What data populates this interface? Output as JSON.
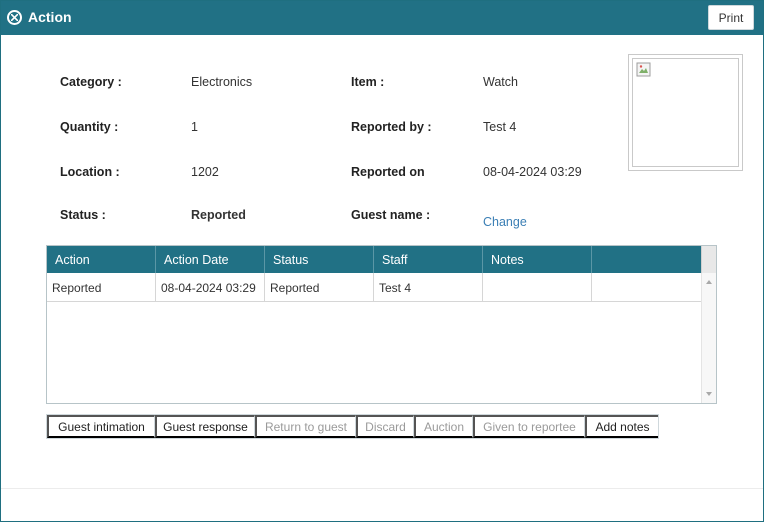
{
  "window": {
    "title": "Action",
    "print_label": "Print"
  },
  "details": {
    "category_label": "Category :",
    "category_value": "Electronics",
    "item_label": "Item :",
    "item_value": "Watch",
    "quantity_label": "Quantity :",
    "quantity_value": "1",
    "reported_by_label": "Reported by :",
    "reported_by_value": "Test 4",
    "location_label": "Location :",
    "location_value": "1202",
    "reported_on_label": "Reported on",
    "reported_on_value": "08-04-2024 03:29",
    "status_label": "Status :",
    "status_value": "Reported",
    "guest_name_label": "Guest name :",
    "change_link": "Change"
  },
  "grid": {
    "columns": [
      "Action",
      "Action Date",
      "Status",
      "Staff",
      "Notes",
      ""
    ],
    "rows": [
      [
        "Reported",
        "08-04-2024 03:29",
        "Reported",
        "Test 4",
        "",
        ""
      ]
    ]
  },
  "actions": [
    {
      "label": "Guest intimation",
      "enabled": true
    },
    {
      "label": "Guest response",
      "enabled": true
    },
    {
      "label": "Return to guest",
      "enabled": false
    },
    {
      "label": "Discard",
      "enabled": false
    },
    {
      "label": "Auction",
      "enabled": false
    },
    {
      "label": "Given to reportee",
      "enabled": false
    },
    {
      "label": "Add notes",
      "enabled": true
    }
  ],
  "icons": {
    "close": "close-circle-icon",
    "photo": "broken-image-icon"
  },
  "colors": {
    "header": "#217185",
    "link": "#3b7fb5",
    "disabled_text": "#9a9a9a"
  }
}
